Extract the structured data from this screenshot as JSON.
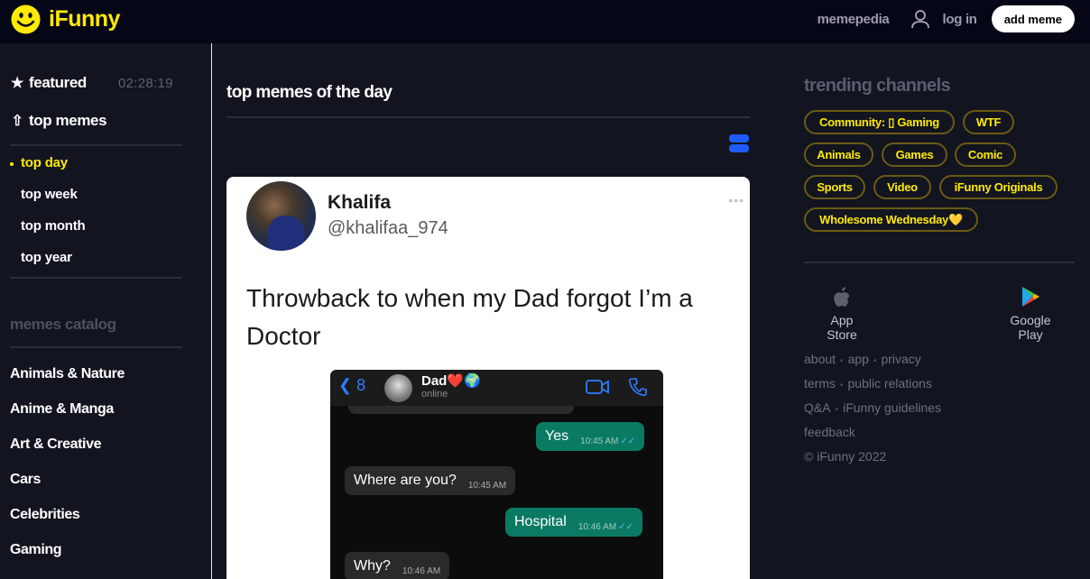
{
  "header": {
    "logo_text": "iFunny",
    "memepedia": "memepedia",
    "login": "log in",
    "add_meme": "add meme",
    "icons": {
      "logo": "smiley-icon",
      "user": "user-icon"
    }
  },
  "sidebar": {
    "featured": {
      "label": "featured",
      "timer": "02:28:19",
      "icon": "star-icon"
    },
    "top_memes": {
      "label": "top memes",
      "icon": "arrow-up-icon"
    },
    "sub_items": [
      {
        "label": "top day",
        "active": true
      },
      {
        "label": "top week",
        "active": false
      },
      {
        "label": "top month",
        "active": false
      },
      {
        "label": "top year",
        "active": false
      }
    ],
    "catalog_title": "memes catalog",
    "catalog": [
      {
        "label": "Animals & Nature"
      },
      {
        "label": "Anime & Manga"
      },
      {
        "label": "Art & Creative"
      },
      {
        "label": "Cars"
      },
      {
        "label": "Celebrities"
      },
      {
        "label": "Gaming"
      }
    ]
  },
  "main": {
    "title": "top memes of the day",
    "view_toggle_icon": "list-view-icon",
    "post": {
      "tweet_name": "Khalifa",
      "tweet_handle": "@khalifaa_974",
      "tweet_menu": "•••",
      "tweet_text": "Throwback to when my Dad forgot I’m a Doctor",
      "chat": {
        "back_label": "8",
        "contact_name": "Dad❤️🌍",
        "contact_status": "online",
        "messages": [
          {
            "dir": "out",
            "text": "Yes",
            "time": "10:45 AM",
            "ticks": "✓✓"
          },
          {
            "dir": "in",
            "text": "Where are you?",
            "time": "10:45 AM"
          },
          {
            "dir": "out",
            "text": "Hospital",
            "time": "10:46 AM",
            "ticks": "✓✓"
          },
          {
            "dir": "in",
            "text": "Why?",
            "time": "10:46 AM"
          }
        ]
      }
    }
  },
  "right": {
    "trending_title": "trending channels",
    "channels": [
      {
        "label": "Community: ▯ Gaming"
      },
      {
        "label": "WTF"
      },
      {
        "label": "Animals"
      },
      {
        "label": "Games"
      },
      {
        "label": "Comic"
      },
      {
        "label": "Sports"
      },
      {
        "label": "Video"
      },
      {
        "label": "iFunny Originals"
      },
      {
        "label": "Wholesome Wednesday💛"
      }
    ],
    "app_store": "App Store",
    "google_play": "Google Play",
    "footer_links": [
      [
        "about",
        "app",
        "privacy"
      ],
      [
        "terms",
        "public relations"
      ],
      [
        "Q&A",
        "iFunny guidelines"
      ],
      [
        "feedback"
      ]
    ],
    "copyright": "© iFunny 2022"
  },
  "colors": {
    "brand_yellow": "#ffea00",
    "header_bg": "#050616",
    "page_bg": "#12141f",
    "accent_blue": "#1f5cff"
  }
}
